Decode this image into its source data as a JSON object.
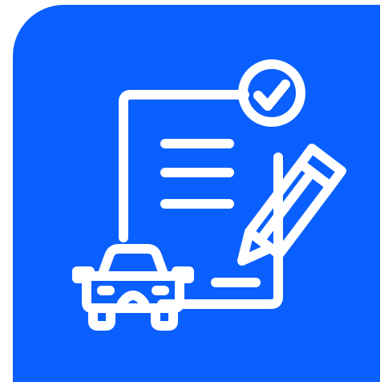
{
  "icon": {
    "name": "car-document-sign-icon",
    "parts": [
      "document-icon",
      "check-badge-icon",
      "pencil-icon",
      "car-icon"
    ],
    "colors": {
      "background": "#0A5FFF",
      "foreground": "#FFFFFF"
    }
  }
}
